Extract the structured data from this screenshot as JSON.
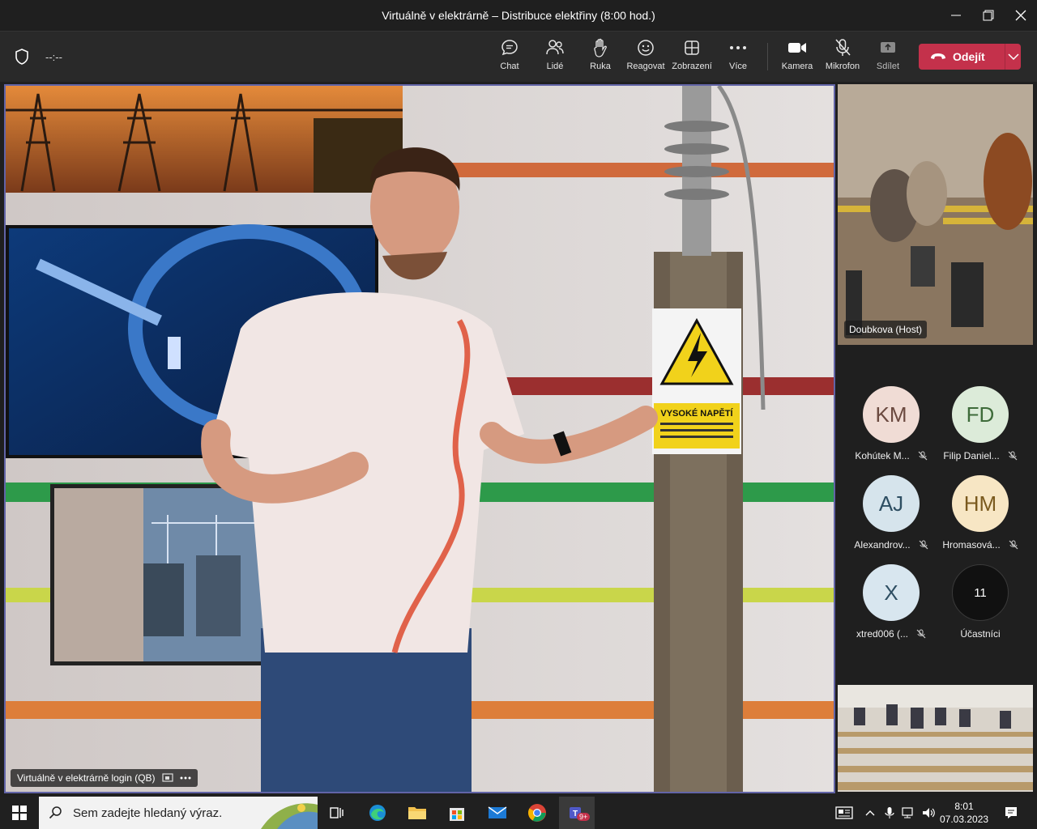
{
  "window": {
    "title": "Virtuálně v elektrárně – Distribuce elektřiny (8:00 hod.)"
  },
  "meeting": {
    "timer": "--:--"
  },
  "toolbar": {
    "chat": "Chat",
    "people": "Lidé",
    "raise": "Ruka",
    "react": "Reagovat",
    "view": "Zobrazení",
    "more": "Více",
    "camera": "Kamera",
    "mic": "Mikrofon",
    "share": "Sdílet",
    "leave": "Odejít"
  },
  "stage": {
    "presenter_name": "Virtuálně v elektrárně login (QB)",
    "sign_text": "VYSOKÉ NAPĚTÍ"
  },
  "tiles": {
    "top_name": "Doubkova (Host)"
  },
  "participants": [
    {
      "initials": "KM",
      "name": "Kohútek M...",
      "bg": "#f0dcd5",
      "fg": "#6b4a40"
    },
    {
      "initials": "FD",
      "name": "Filip Daniel...",
      "bg": "#dcebd9",
      "fg": "#3e6b3a"
    },
    {
      "initials": "AJ",
      "name": "Alexandrov...",
      "bg": "#d6e4ec",
      "fg": "#2e4e62"
    },
    {
      "initials": "HM",
      "name": "Hromasová...",
      "bg": "#f7e6c4",
      "fg": "#7a5a1e"
    },
    {
      "initials": "X",
      "name": "xtred006 (...",
      "bg": "#d8e6ef",
      "fg": "#2e4e62"
    }
  ],
  "participants_more": {
    "count": "11",
    "label": "Účastníci"
  },
  "taskbar": {
    "search_placeholder": "Sem zadejte hledaný výraz.",
    "teams_badge": "9+",
    "time": "8:01",
    "date": "07.03.2023"
  },
  "colors": {
    "accent": "#6264a7",
    "leave": "#c4314b"
  }
}
